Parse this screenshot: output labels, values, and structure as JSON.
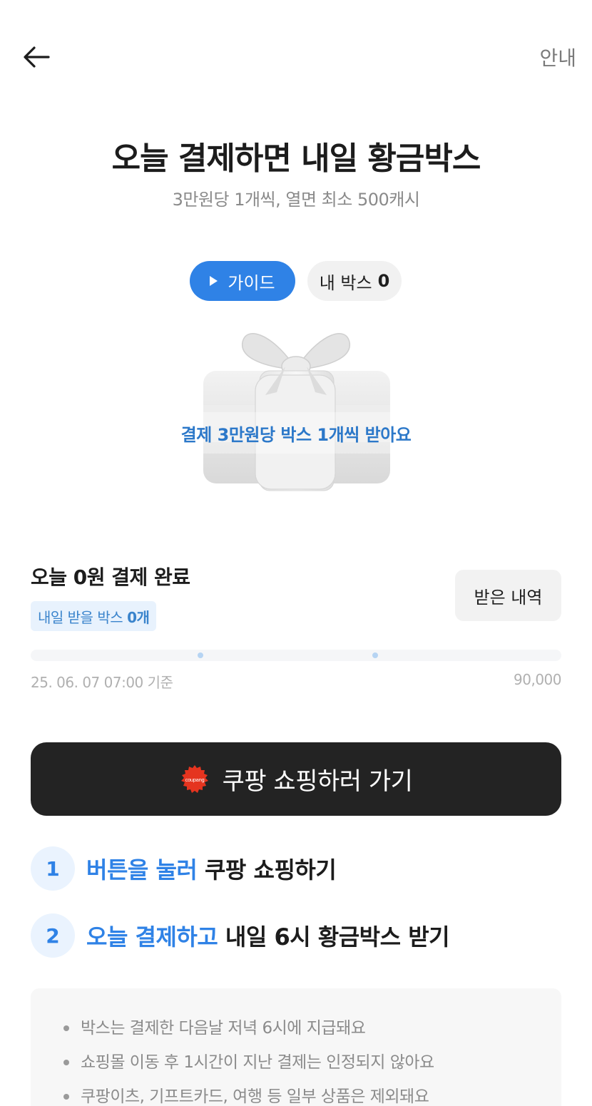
{
  "header": {
    "back_icon": "arrow-left-icon",
    "info_label": "안내"
  },
  "hero": {
    "title": "오늘 결제하면 내일 황금박스",
    "subtitle": "3만원당 1개씩, 열면 최소 500캐시"
  },
  "chips": {
    "guide_label": "가이드",
    "mybox_label": "내 박스",
    "mybox_count": "0"
  },
  "gift": {
    "icon": "gift-box-icon",
    "caption": "결제 3만원당 박스 1개씩 받아요"
  },
  "status": {
    "title": "오늘 0원 결제 완료",
    "tomorrow_label": "내일 받을 박스",
    "tomorrow_count": "0개",
    "history_button": "받은 내역",
    "progress_fraction": 0,
    "as_of": "25. 06. 07 07:00 기준",
    "goal": "90,000"
  },
  "cta": {
    "logo_text": "coupang",
    "label": "쿠팡 쇼핑하러 가기"
  },
  "steps": [
    {
      "num": "1",
      "highlight": "버튼을 눌러",
      "rest": "쿠팡 쇼핑하기"
    },
    {
      "num": "2",
      "highlight": "오늘 결제하고",
      "rest": "내일 6시 황금박스 받기"
    }
  ],
  "notices": [
    "박스는 결제한 다음날 저녁 6시에 지급돼요",
    "쇼핑몰 이동 후 1시간이 지난 결제는 인정되지 않아요",
    "쿠팡이츠, 기프트카드, 여행 등 일부 상품은 제외돼요"
  ],
  "colors": {
    "accent": "#2f82e6",
    "cta_bg": "#232323",
    "coupang_red": "#e5341f"
  }
}
